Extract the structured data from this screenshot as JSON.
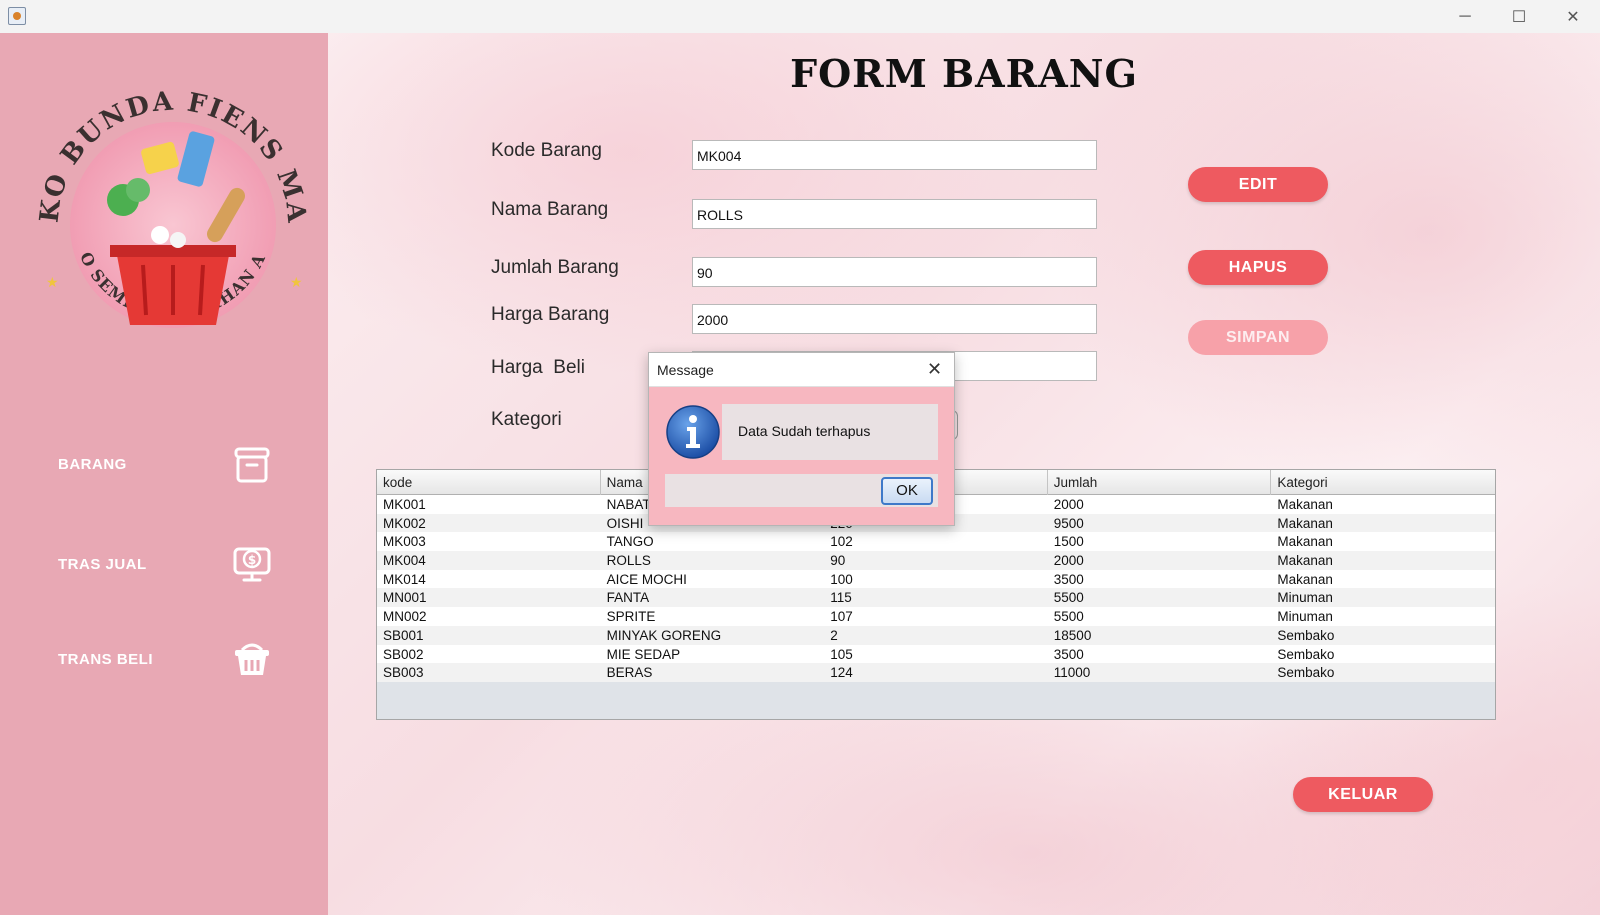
{
  "window": {
    "minimize_glyph": "─",
    "maximize_glyph": "☐",
    "close_glyph": "✕"
  },
  "logo": {
    "arc_text_top": "TOKO BUNDA FIENS MART",
    "arc_text_bottom": "TOKO SEMBAKO PILIHAN ANDA"
  },
  "sidebar": {
    "items": [
      {
        "label": "BARANG",
        "icon": "box-icon"
      },
      {
        "label": "TRAS JUAL",
        "icon": "money-monitor-icon"
      },
      {
        "label": "TRANS BELI",
        "icon": "basket-icon"
      }
    ]
  },
  "form": {
    "title": "FORM BARANG",
    "fields": [
      {
        "label": "Kode Barang",
        "value": "MK004"
      },
      {
        "label": "Nama Barang",
        "value": "ROLLS"
      },
      {
        "label": "Jumlah Barang",
        "value": "90"
      },
      {
        "label": "Harga Barang",
        "value": "2000"
      },
      {
        "label": "Harga  Beli",
        "value": ""
      },
      {
        "label": "Kategori",
        "value": ""
      }
    ]
  },
  "buttons": {
    "edit": "EDIT",
    "hapus": "HAPUS",
    "simpan": "SIMPAN",
    "keluar": "KELUAR"
  },
  "table": {
    "columns": [
      "kode",
      "Nama",
      "",
      "Jumlah",
      "Kategori"
    ],
    "rows": [
      [
        "MK001",
        "NABATI",
        "",
        "2000",
        "Makanan"
      ],
      [
        "MK002",
        "OISHI",
        "220",
        "9500",
        "Makanan"
      ],
      [
        "MK003",
        "TANGO",
        "102",
        "1500",
        "Makanan"
      ],
      [
        "MK004",
        "ROLLS",
        "90",
        "2000",
        "Makanan"
      ],
      [
        "MK014",
        "AICE MOCHI",
        "100",
        "3500",
        "Makanan"
      ],
      [
        "MN001",
        "FANTA",
        "115",
        "5500",
        "Minuman"
      ],
      [
        "MN002",
        "SPRITE",
        "107",
        "5500",
        "Minuman"
      ],
      [
        "SB001",
        "MINYAK GORENG",
        "2",
        "18500",
        "Sembako"
      ],
      [
        "SB002",
        "MIE SEDAP",
        "105",
        "3500",
        "Sembako"
      ],
      [
        "SB003",
        "BERAS",
        "124",
        "11000",
        "Sembako"
      ]
    ]
  },
  "dialog": {
    "title": "Message",
    "message": "Data Sudah terhapus",
    "ok_label": "OK",
    "close_glyph": "✕",
    "icon": "info-icon"
  },
  "colors": {
    "sidebar": "#e8a8b4",
    "accent_button": "#ee5a60",
    "disabled_button": "#f7a1a9",
    "dialog_bg": "#f7b7c0"
  }
}
